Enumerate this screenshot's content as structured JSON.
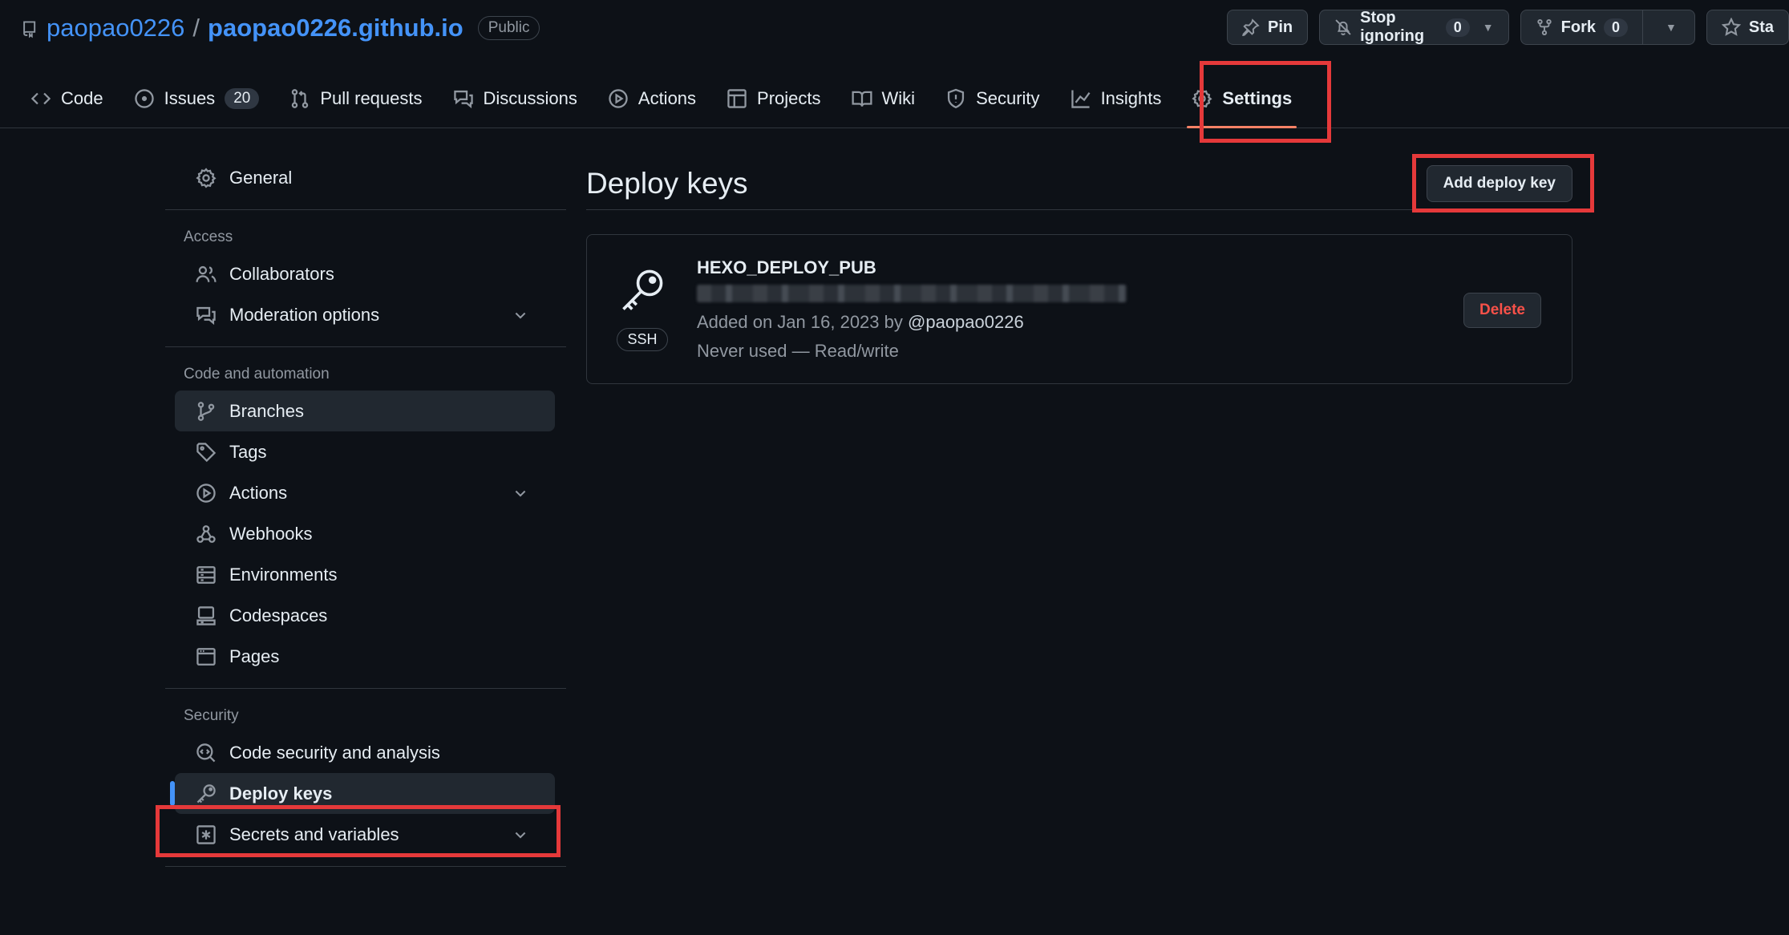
{
  "repo": {
    "owner": "paopao0226",
    "separator": "/",
    "name": "paopao0226.github.io",
    "visibility": "Public"
  },
  "header_actions": {
    "pin_label": "Pin",
    "watch_label": "Stop ignoring",
    "watch_count": "0",
    "fork_label": "Fork",
    "fork_count": "0",
    "star_label": "Sta"
  },
  "tabs": [
    {
      "label": "Code",
      "icon": "code-icon"
    },
    {
      "label": "Issues",
      "icon": "issue-icon",
      "count": "20"
    },
    {
      "label": "Pull requests",
      "icon": "pull-request-icon"
    },
    {
      "label": "Discussions",
      "icon": "discussion-icon"
    },
    {
      "label": "Actions",
      "icon": "play-icon"
    },
    {
      "label": "Projects",
      "icon": "table-icon"
    },
    {
      "label": "Wiki",
      "icon": "book-icon"
    },
    {
      "label": "Security",
      "icon": "shield-icon"
    },
    {
      "label": "Insights",
      "icon": "graph-icon"
    },
    {
      "label": "Settings",
      "icon": "gear-icon",
      "selected": true
    }
  ],
  "sidebar": {
    "general": "General",
    "access_heading": "Access",
    "access": [
      "Collaborators",
      "Moderation options"
    ],
    "automation_heading": "Code and automation",
    "automation": [
      "Branches",
      "Tags",
      "Actions",
      "Webhooks",
      "Environments",
      "Codespaces",
      "Pages"
    ],
    "security_heading": "Security",
    "security": [
      "Code security and analysis",
      "Deploy keys",
      "Secrets and variables"
    ]
  },
  "main": {
    "title": "Deploy keys",
    "add_button": "Add deploy key",
    "key": {
      "type": "SSH",
      "name": "HEXO_DEPLOY_PUB",
      "added_prefix": "Added on Jan 16, 2023 by",
      "added_by": "@paopao0226",
      "usage": "Never used — Read/write",
      "delete_label": "Delete"
    }
  },
  "colors": {
    "background": "#0d1117",
    "accent": "#4493f8",
    "tab_underline": "#f78166",
    "danger": "#f85149",
    "annotation": "#e5393a"
  }
}
